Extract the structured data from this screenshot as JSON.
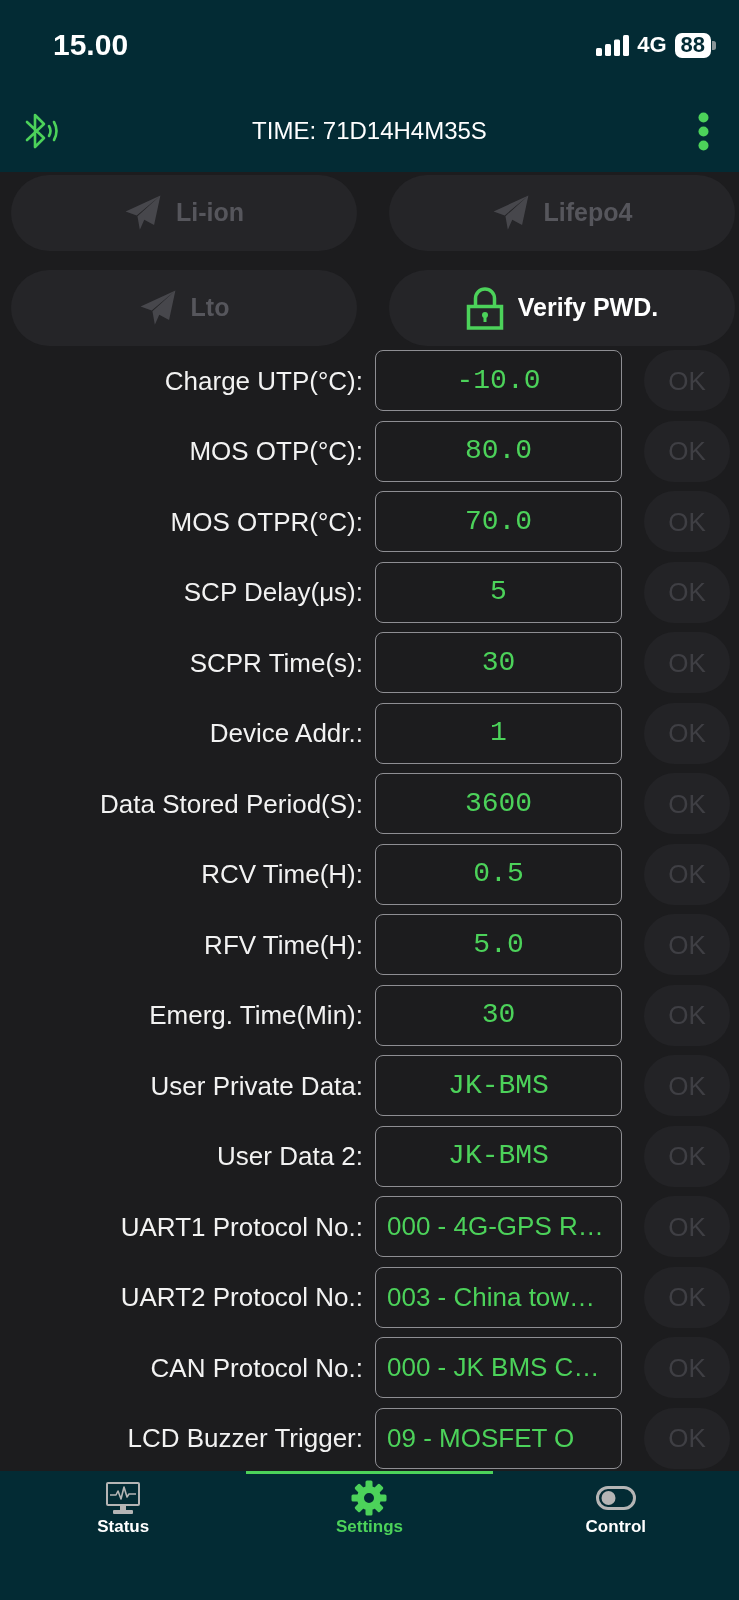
{
  "status_bar": {
    "time": "15.00",
    "network": "4G",
    "battery": "88"
  },
  "app_bar": {
    "title": "TIME: 71D14H4M35S"
  },
  "presets": [
    {
      "kind": "preset",
      "label": "Li-ion",
      "disabled": true
    },
    {
      "kind": "preset",
      "label": "Lifepo4",
      "disabled": true
    },
    {
      "kind": "preset",
      "label": "Lto",
      "disabled": true
    },
    {
      "kind": "verify",
      "label": "Verify PWD.",
      "disabled": false
    }
  ],
  "settings": [
    {
      "kind": "input",
      "label": "Charge UTP(°C):",
      "value": "-10.0",
      "ok": {
        "label": "OK",
        "disabled": true
      }
    },
    {
      "kind": "input",
      "label": "MOS OTP(°C):",
      "value": "80.0",
      "ok": {
        "label": "OK",
        "disabled": true
      }
    },
    {
      "kind": "input",
      "label": "MOS OTPR(°C):",
      "value": "70.0",
      "ok": {
        "label": "OK",
        "disabled": true
      }
    },
    {
      "kind": "input",
      "label": "SCP Delay(μs):",
      "value": "5",
      "ok": {
        "label": "OK",
        "disabled": true
      }
    },
    {
      "kind": "input",
      "label": "SCPR Time(s):",
      "value": "30",
      "ok": {
        "label": "OK",
        "disabled": true
      }
    },
    {
      "kind": "input",
      "label": "Device Addr.:",
      "value": "1",
      "ok": {
        "label": "OK",
        "disabled": true
      }
    },
    {
      "kind": "input",
      "label": "Data Stored Period(S):",
      "value": "3600",
      "ok": {
        "label": "OK",
        "disabled": true
      }
    },
    {
      "kind": "input",
      "label": "RCV Time(H):",
      "value": "0.5",
      "ok": {
        "label": "OK",
        "disabled": true
      }
    },
    {
      "kind": "input",
      "label": "RFV Time(H):",
      "value": "5.0",
      "ok": {
        "label": "OK",
        "disabled": true
      }
    },
    {
      "kind": "input",
      "label": "Emerg. Time(Min):",
      "value": "30",
      "ok": {
        "label": "OK",
        "disabled": true
      }
    },
    {
      "kind": "input",
      "label": "User Private Data:",
      "value": "JK-BMS",
      "ok": {
        "label": "OK",
        "disabled": true
      }
    },
    {
      "kind": "input",
      "label": "User Data 2:",
      "value": "JK-BMS",
      "ok": {
        "label": "OK",
        "disabled": true
      }
    },
    {
      "kind": "select",
      "label": "UART1 Protocol No.:",
      "value": "000 - 4G-GPS R…",
      "ok": {
        "label": "OK",
        "disabled": true
      }
    },
    {
      "kind": "select",
      "label": "UART2 Protocol No.:",
      "value": "003 - China tow…",
      "ok": {
        "label": "OK",
        "disabled": true
      }
    },
    {
      "kind": "select",
      "label": "CAN Protocol No.:",
      "value": "000 - JK BMS C…",
      "ok": {
        "label": "OK",
        "disabled": true
      }
    },
    {
      "kind": "select",
      "label": "LCD Buzzer Trigger:",
      "value": "09 - MOSFET O",
      "ok": {
        "label": "OK",
        "disabled": true
      }
    }
  ],
  "tab_bar": [
    {
      "label": "Status",
      "selected": false
    },
    {
      "label": "Settings",
      "selected": true
    },
    {
      "label": "Control",
      "selected": false
    }
  ]
}
